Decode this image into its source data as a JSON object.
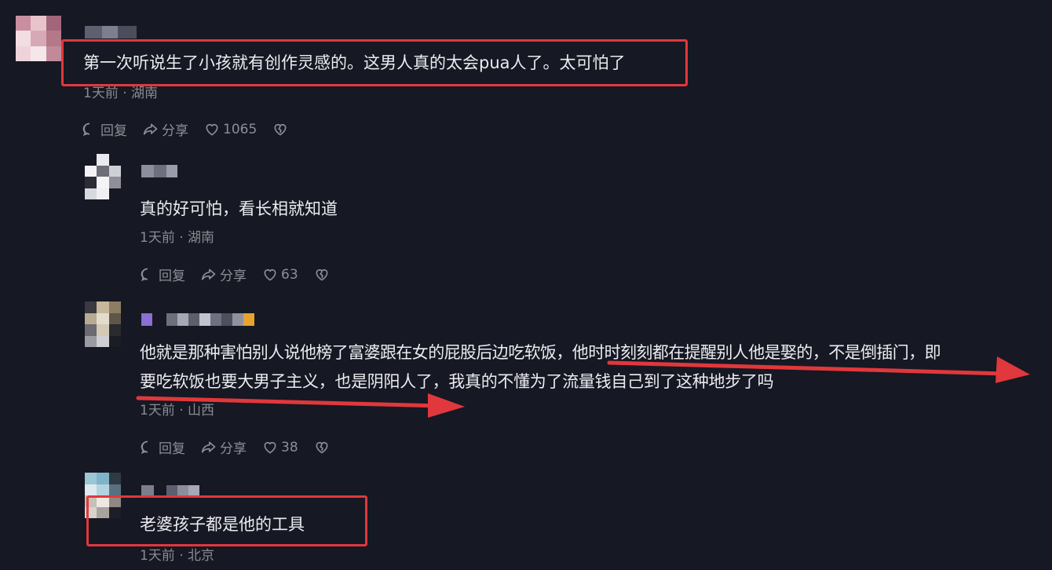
{
  "comments": [
    {
      "text": "第一次听说生了小孩就有创作灵感的。这男人真的太会pua人了。太可怕了",
      "meta": "1天前 · 湖南",
      "reply_label": "回复",
      "share_label": "分享",
      "likes": "1065"
    },
    {
      "text": "真的好可怕，看长相就知道",
      "meta": "1天前 · 湖南",
      "reply_label": "回复",
      "share_label": "分享",
      "likes": "63"
    },
    {
      "text_line1": "他就是那种害怕别人说他榜了富婆跟在女的屁股后边吃软饭，他时时刻刻都在提醒别人他是娶的，不是倒插门，即",
      "text_line2": "要吃软饭也要大男子主义，也是阴阳人了，我真的不懂为了流量钱自己到了这种地步了吗",
      "meta": "1天前 · 山西",
      "reply_label": "回复",
      "share_label": "分享",
      "likes": "38"
    },
    {
      "text": "老婆孩子都是他的工具",
      "meta": "1天前 · 北京"
    }
  ],
  "icons": {
    "reply": "comment-bubble-icon",
    "share": "share-arrow-icon",
    "like": "heart-icon",
    "dislike": "broken-heart-icon"
  },
  "colors": {
    "background": "#161823",
    "highlight": "#e0383c",
    "meta_text": "#8a8b92"
  }
}
